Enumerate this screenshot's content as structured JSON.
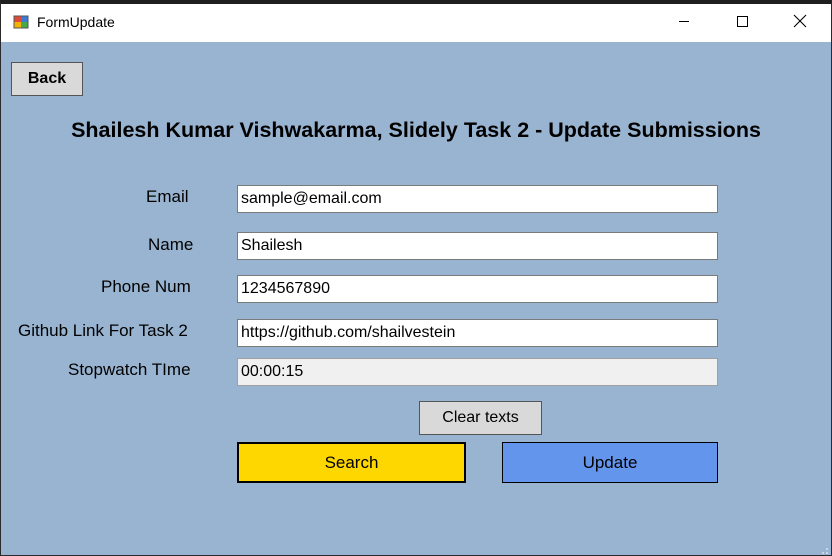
{
  "window": {
    "title": "FormUpdate",
    "client_bg": "#99b4d1"
  },
  "titlebar": {
    "icons": [
      "app-form-icon",
      "minimize-icon",
      "maximize-icon",
      "close-icon"
    ]
  },
  "toolbar": {
    "back_label": "Back"
  },
  "heading": "Shailesh Kumar Vishwakarma, Slidely Task 2 - Update Submissions",
  "form": {
    "email_label": "Email",
    "email_value": "sample@email.com",
    "name_label": "Name",
    "name_value": "Shailesh",
    "phone_label": "Phone Num",
    "phone_value": "1234567890",
    "github_label": "Github Link For Task 2",
    "github_value": "https://github.com/shailvestein",
    "stopwatch_label": "Stopwatch TIme",
    "stopwatch_value": "00:00:15"
  },
  "actions": {
    "clear_label": "Clear texts",
    "search_label": "Search",
    "update_label": "Update",
    "search_color": "#ffd700",
    "update_color": "#6495ed"
  }
}
